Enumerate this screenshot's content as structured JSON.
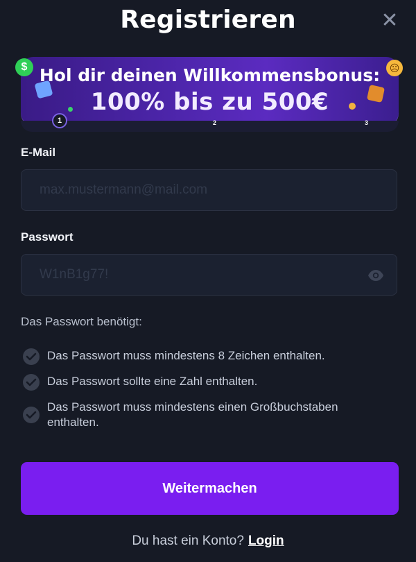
{
  "modal": {
    "title": "Registrieren",
    "close_icon": "close-icon"
  },
  "banner": {
    "line1": "Hol dir deinen Willkommensbonus:",
    "line2": "100% bis zu 500€",
    "steps": [
      "1",
      "2",
      "3"
    ],
    "coin_symbol": "$",
    "emoji_symbol": "☹"
  },
  "form": {
    "email_label": "E-Mail",
    "email_placeholder": "max.mustermann@mail.com",
    "password_label": "Passwort",
    "password_placeholder": "W1nB1g77!",
    "password_toggle_icon": "eye-icon"
  },
  "requirements": {
    "title": "Das Passwort benötigt:",
    "items": [
      "Das Passwort muss mindestens 8 Zeichen enthalten.",
      "Das Passwort sollte eine Zahl enthalten.",
      "Das Passwort muss mindestens einen Großbuchstaben enthalten."
    ]
  },
  "actions": {
    "continue_label": "Weitermachen",
    "account_question": "Du hast ein Konto?",
    "login_label": "Login"
  },
  "colors": {
    "background": "#161a25",
    "accent": "#7a1ef0",
    "input_bg": "#1b2130",
    "banner_purple": "#4a24a6"
  }
}
